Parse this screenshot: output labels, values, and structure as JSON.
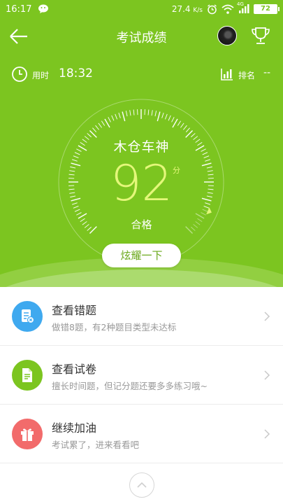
{
  "status_bar": {
    "time": "16:17",
    "network_speed": "27.4",
    "network_unit": "K/s",
    "network_type": "4G",
    "battery": "72",
    "icons": [
      "wechat-icon",
      "alarm-icon",
      "wifi-icon",
      "signal-icon",
      "battery-icon"
    ]
  },
  "header": {
    "title": "考试成绩",
    "back_icon": "arrow-left-icon",
    "trophy_icon": "trophy-icon"
  },
  "stats": {
    "time_label": "用时",
    "time_value": "18:32",
    "rank_label": "排名",
    "rank_value": "--"
  },
  "result": {
    "title": "木仓车神",
    "score": "92",
    "unit": "分",
    "status": "合格",
    "score_fraction": 0.92,
    "share_label": "炫耀一下"
  },
  "menu": [
    {
      "title": "查看错题",
      "subtitle": "做错8题，有2种题目类型未达标",
      "icon": "wrong-questions-icon",
      "color": "#3fa9ef"
    },
    {
      "title": "查看试卷",
      "subtitle": "擅长时间题，但记分题还要多多练习哦~",
      "icon": "exam-paper-icon",
      "color": "#7cc520"
    },
    {
      "title": "继续加油",
      "subtitle": "考试累了，进来看看吧",
      "icon": "gift-icon",
      "color": "#f26b6b"
    }
  ],
  "colors": {
    "primary_green": "#7cc520",
    "score_yellow": "#e4f77a"
  }
}
